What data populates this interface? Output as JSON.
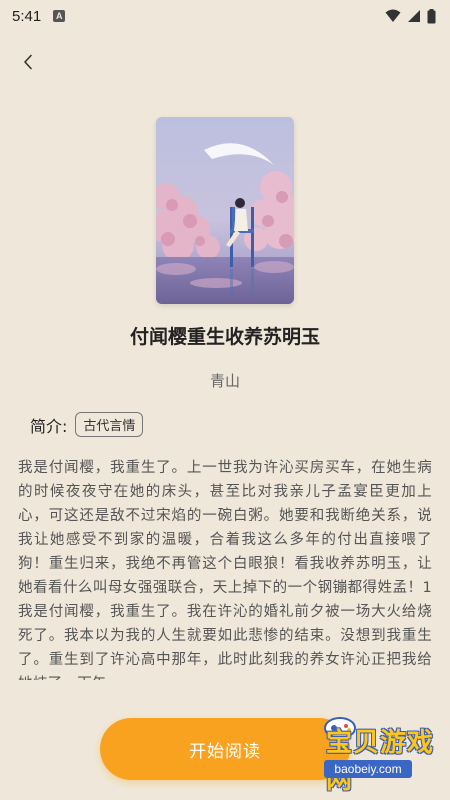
{
  "status_bar": {
    "time": "5:41",
    "notification_icon": "a-icon",
    "icons": [
      "wifi-icon",
      "signal-icon",
      "battery-icon"
    ]
  },
  "nav": {
    "back_icon": "chevron-left-icon"
  },
  "book": {
    "title": "付闻樱重生收养苏明玉",
    "author": "青山",
    "intro_label": "简介:",
    "genre": "古代言情",
    "synopsis": "我是付闻樱，我重生了。上一世我为许沁买房买车，在她生病的时候夜夜守在她的床头，甚至比对我亲儿子孟宴臣更加上心，可这还是敌不过宋焰的一碗白粥。她要和我断绝关系，说我让她感受不到家的温暖，合着我这么多年的付出直接喂了狗！重生归来，我绝不再管这个白眼狼！看我收养苏明玉，让她看看什么叫母女强强联合，天上掉下的一个钢镚都得姓孟！1我是付闻樱，我重生了。我在许沁的婚礼前夕被一场大火给烧死了。我本以为我的人生就要如此悲惨的结束。没想到我重生了。重生到了许沁高中那年，此时此刻我的养女许沁正把我给她炖了一下午"
  },
  "actions": {
    "start_reading": "开始阅读"
  },
  "watermark": {
    "text": "宝贝游戏网",
    "domain": "baobeiy.com"
  },
  "colors": {
    "background": "#efe8da",
    "accent": "#f9a21f"
  }
}
